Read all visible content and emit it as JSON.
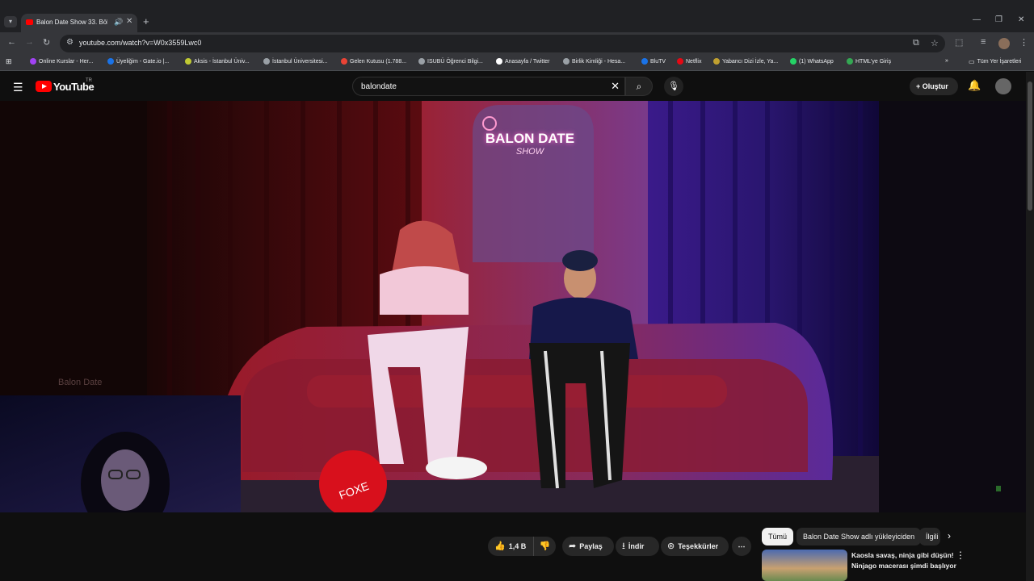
{
  "browser": {
    "tab_title": "Balon Date Show 33. Bölüm",
    "url": "youtube.com/watch?v=W0x3559Lwc0",
    "bookmarks": [
      {
        "label": "Online Kurslar - Her...",
        "color": "#a142f4"
      },
      {
        "label": "Üyeliğim - Gate.io |...",
        "color": "#1a73e8"
      },
      {
        "label": "Aksis - İstanbul Üniv...",
        "color": "#c0ca33"
      },
      {
        "label": "İstanbul Üniversitesi...",
        "color": "#9aa0a6"
      },
      {
        "label": "Gelen Kutusu (1.788...",
        "color": "#ea4335"
      },
      {
        "label": "ISUBÜ Öğrenci Bilgi...",
        "color": "#9aa0a6"
      },
      {
        "label": "Anasayfa / Twitter",
        "color": "#ffffff"
      },
      {
        "label": "Birlik Kimliği - Hesa...",
        "color": "#9aa0a6"
      },
      {
        "label": "BluTV",
        "color": "#1a73e8"
      },
      {
        "label": "Netflix",
        "color": "#e50914"
      },
      {
        "label": "Yabancı Dizi İzle, Ya...",
        "color": "#c0a030"
      },
      {
        "label": "(1) WhatsApp",
        "color": "#25d366"
      },
      {
        "label": "HTML'ye Giriş",
        "color": "#34a853"
      }
    ],
    "all_bookmarks": "Tüm Yer İşaretleri"
  },
  "youtube": {
    "logo_text": "YouTube",
    "region": "TR",
    "search_query": "balondate",
    "create_label": "Oluştur"
  },
  "video": {
    "neon_line1": "BALON DATE",
    "neon_line2": "SHOW",
    "balloon_text": "FOXE",
    "watermark": "Balon Date"
  },
  "actions": {
    "likes": "1,4 B",
    "share": "Paylaş",
    "download": "İndir",
    "thanks": "Teşekkürler"
  },
  "chips": [
    "Tümü",
    "Balon Date Show adlı yükleyiciden",
    "İlgili"
  ],
  "recommendation": {
    "title_line1": "Kaosla savaş, ninja gibi düşün!",
    "title_line2": "Ninjago macerası şimdi başlıyor"
  }
}
